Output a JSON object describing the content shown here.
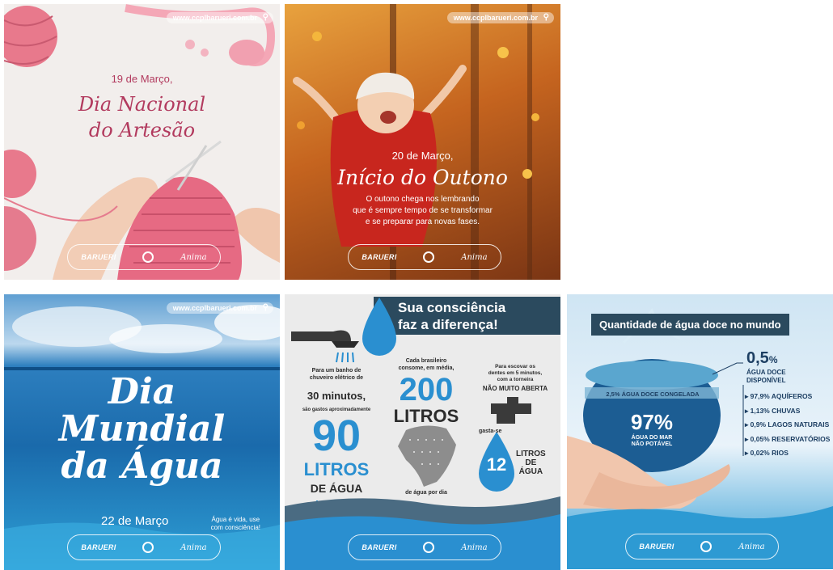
{
  "footer": {
    "brand": "BARUERI",
    "partner": "Anima"
  },
  "posts": {
    "artesao": {
      "url": "www.ccplbarueri.com.br",
      "date": "19 de Março,",
      "title_line1": "Dia Nacional",
      "title_line2": "do Artesão",
      "colors": {
        "background": "#f2eeec",
        "text": "#b23a5e",
        "yarn": "#e57b8e"
      }
    },
    "outono": {
      "url": "www.ccplbarueri.com.br",
      "date": "20 de Março,",
      "title": "Início do Outono",
      "text_line1": "O outono chega nos lembrando",
      "text_line2": "que é sempre tempo de se transformar",
      "text_line3": "e se preparar para novas fases.",
      "colors": {
        "background": "#b8571b",
        "accent": "#f0a030"
      }
    },
    "dia_agua": {
      "url": "www.ccplbarueri.com.br",
      "title_line1": "Dia",
      "title_line2": "Mundial",
      "title_line3": "da Água",
      "date": "22 de Março",
      "note_line1": "Água é vida, use",
      "note_line2": "com consciência!",
      "colors": {
        "sky": "#6aa6d6",
        "sea": "#1c78b8"
      }
    },
    "consciencia": {
      "header_line1": "Sua consciência",
      "header_line2": "faz a diferença!",
      "shower_text_line1": "Para um banho de",
      "shower_text_line2": "chuveiro elétrico de",
      "shower_minutes": "30 minutos,",
      "shower_text_line3": "são gastos aproximadamente",
      "shower_number": "90",
      "shower_unit": "LITROS",
      "shower_unit2": "DE ÁGUA",
      "brazil_text_line1": "Cada brasileiro",
      "brazil_text_line2": "consome, em média,",
      "brazil_number": "200",
      "brazil_unit": "LITROS",
      "brazil_caption": "de água por dia",
      "tap_text_line1": "Para escovar os",
      "tap_text_line2": "dentes em 5 minutos,",
      "tap_text_line3": "com a torneira",
      "tap_emphasis": "NÃO MUITO ABERTA",
      "tap_text_line4": "gasta-se",
      "tap_number": "12",
      "tap_unit1": "LITROS",
      "tap_unit2": "DE",
      "tap_unit3": "ÁGUA",
      "colors": {
        "header": "#2b4a5e",
        "blue": "#2a8fd0",
        "dark": "#2b2b2b"
      }
    },
    "agua_doce": {
      "header": "Quantidade de água doce no mundo",
      "top_percent": "0,5",
      "top_percent_sign": "%",
      "top_label_line1": "ÁGUA DOCE",
      "top_label_line2": "DISPONÍVEL",
      "frozen_label": "2,5% ÁGUA DOCE CONGELADA",
      "sea_percent": "97%",
      "sea_label_line1": "ÁGUA DO MAR",
      "sea_label_line2": "NÃO POTÁVEL",
      "items": [
        "97,9% AQUÍFEROS",
        "1,13% CHUVAS",
        "0,9% LAGOS NATURAIS",
        "0,05% RESERVATÓRIOS",
        "0,02% RIOS"
      ],
      "colors": {
        "header": "#2b4a5e",
        "text": "#1d3f63"
      }
    }
  }
}
